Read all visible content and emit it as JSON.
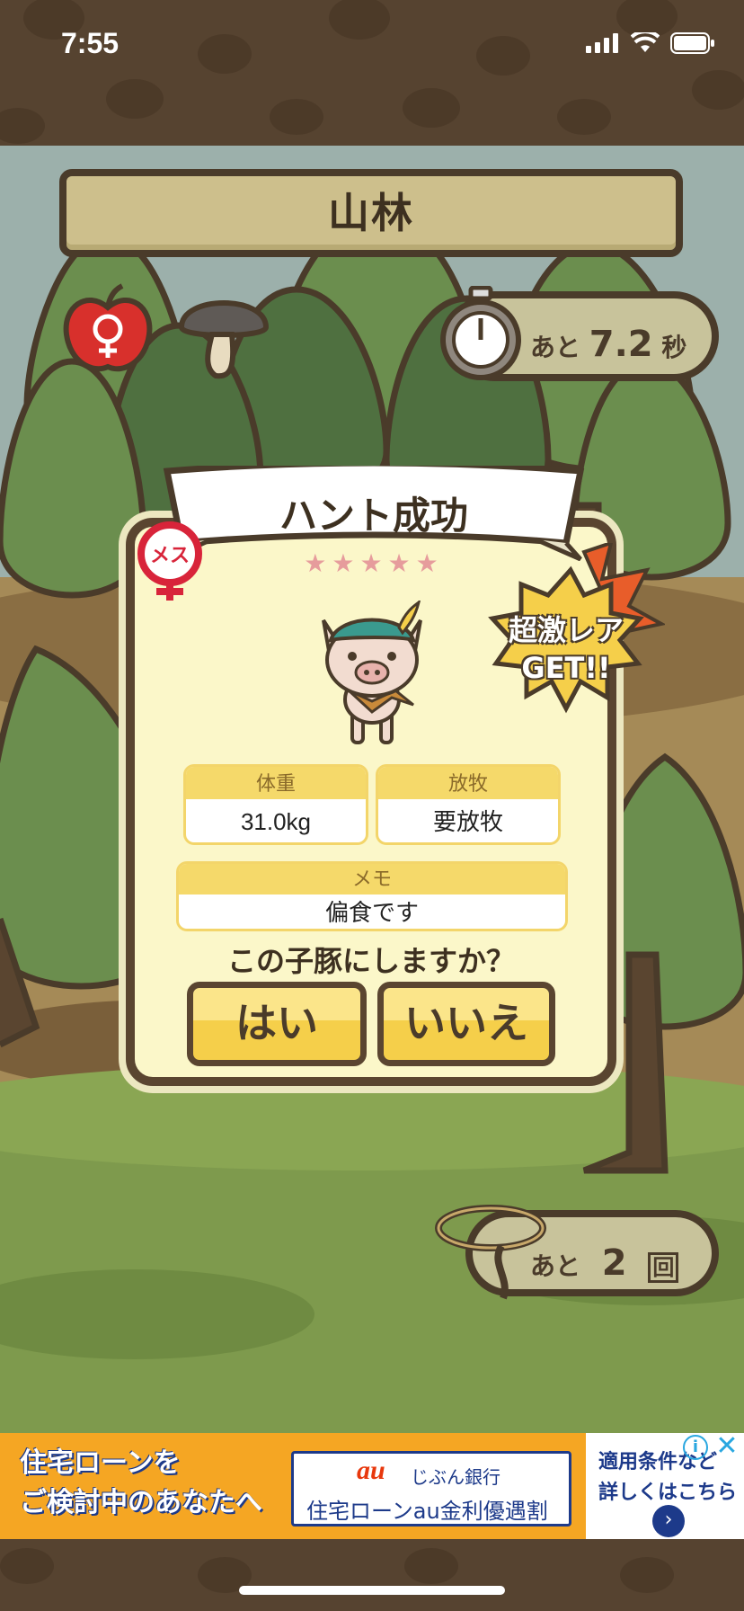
{
  "status_bar": {
    "time": "7:55"
  },
  "location": {
    "title": "山林"
  },
  "timer": {
    "prefix": "あと",
    "value": "7.2",
    "unit": "秒"
  },
  "attempts": {
    "prefix": "あと",
    "value": "2",
    "unit": "回"
  },
  "result": {
    "title": "ハント成功",
    "stars": "★★★★★",
    "gender_label": "メス",
    "rarity_line1": "超激レア",
    "rarity_line2": "GET!!",
    "weight_header": "体重",
    "weight_value": "31.0kg",
    "grazing_header": "放牧",
    "grazing_value": "要放牧",
    "memo_header": "メモ",
    "memo_value": "偏食です",
    "question": "この子豚にしますか？",
    "yes_label": "はい",
    "no_label": "いいえ"
  },
  "ad": {
    "left_line1": "住宅ローンを",
    "left_line2": "ご検討中のあなたへ",
    "brand": "au",
    "bank": "じぶん銀行",
    "loan": "住宅ローンau金利優遇割",
    "right_line1": "適用条件など",
    "right_line2": "詳しくはこちら",
    "info": "i",
    "close": "✕",
    "arrow": "›"
  },
  "icons": [
    "cellular-signal-icon",
    "wifi-icon",
    "battery-icon",
    "apple-female-icon",
    "mushroom-icon",
    "stopwatch-icon",
    "lasso-icon",
    "pig-character",
    "female-symbol-icon",
    "rarity-burst-icon"
  ],
  "colors": {
    "wood": "#cdbf8c",
    "outline": "#5a4530",
    "dialog": "#fbf7c9",
    "button": "#f5cf4a",
    "ad_orange": "#f5a623",
    "ad_navy": "#1d3a8a"
  }
}
